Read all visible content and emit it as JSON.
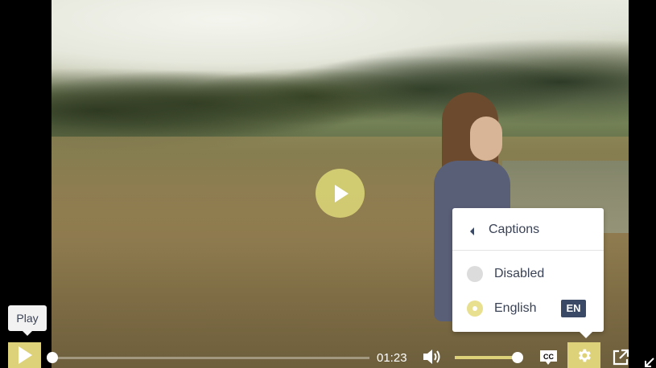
{
  "player": {
    "big_play_icon": "play-icon",
    "tooltip": "Play",
    "time": "01:23",
    "progress_fraction": 0.0,
    "volume_fraction": 1.0,
    "accent_color": "#ddd27a"
  },
  "captions_menu": {
    "title": "Captions",
    "items": [
      {
        "label": "Disabled",
        "selected": false
      },
      {
        "label": "English",
        "selected": true,
        "badge": "EN"
      }
    ]
  },
  "controls": {
    "icons": [
      "play-icon",
      "volume-icon",
      "cc-icon",
      "gear-icon",
      "popout-icon",
      "resize-icon"
    ]
  }
}
